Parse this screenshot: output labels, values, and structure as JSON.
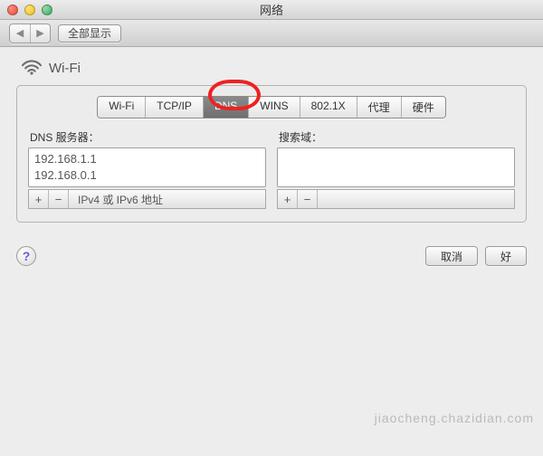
{
  "window": {
    "title": "网络",
    "traffic": {
      "close": "close",
      "minimize": "minimize",
      "zoom": "zoom"
    }
  },
  "toolbar": {
    "back_icon": "◀",
    "fwd_icon": "▶",
    "show_all_label": "全部显示"
  },
  "panel": {
    "name": "Wi-Fi"
  },
  "tabs": [
    {
      "label": "Wi-Fi",
      "active": false
    },
    {
      "label": "TCP/IP",
      "active": false
    },
    {
      "label": "DNS",
      "active": true
    },
    {
      "label": "WINS",
      "active": false
    },
    {
      "label": "802.1X",
      "active": false
    },
    {
      "label": "代理",
      "active": false
    },
    {
      "label": "硬件",
      "active": false
    }
  ],
  "dns": {
    "servers_label": "DNS 服务器：",
    "servers": [
      "192.168.1.1",
      "192.168.0.1"
    ],
    "search_label": "搜索域：",
    "search_domains": [],
    "hint": "IPv4 或 IPv6 地址",
    "add_label": "+",
    "remove_label": "−"
  },
  "footer": {
    "help": "?",
    "cancel_label": "取消",
    "ok_label": "好"
  },
  "annotation": {
    "circle_target_tab": "DNS"
  },
  "watermark": "jiaocheng.chazidian.com"
}
